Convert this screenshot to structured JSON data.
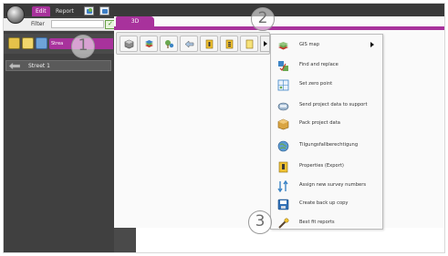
{
  "ribbon": {
    "tabs": [
      {
        "label": "Edit",
        "active": true
      },
      {
        "label": "Report",
        "active": false
      }
    ]
  },
  "filter": {
    "label": "Filter",
    "value": ""
  },
  "panel": {
    "active_tab_label": "Strea",
    "tree": [
      {
        "label": "Street 1",
        "icon": "street-icon"
      }
    ]
  },
  "view": {
    "tab_label": "3D"
  },
  "toolbar": {
    "buttons": [
      "3d-box-icon",
      "layers-icon",
      "tree-icon",
      "route-icon",
      "property-icon",
      "property-export-icon"
    ]
  },
  "menu": {
    "items": [
      {
        "label": "GIS map",
        "icon": "gis-map-icon",
        "has_submenu": true
      },
      {
        "label": "Find and replace",
        "icon": "find-replace-icon",
        "has_submenu": false
      },
      {
        "label": "Set zero point",
        "icon": "zero-point-icon",
        "has_submenu": false
      },
      {
        "label": "Send project data to support",
        "icon": "send-support-icon",
        "has_submenu": false
      },
      {
        "label": "Pack project data",
        "icon": "pack-icon",
        "has_submenu": false
      },
      {
        "label": "Tilgungsfallberechtigung",
        "icon": "globe-icon",
        "has_submenu": false
      },
      {
        "label": "Properties (Export)",
        "icon": "properties-export-icon",
        "has_submenu": false
      },
      {
        "label": "Assign new survey numbers",
        "icon": "survey-numbers-icon",
        "has_submenu": false
      },
      {
        "label": "Create back up copy",
        "icon": "backup-icon",
        "has_submenu": false
      },
      {
        "label": "Best fit reports",
        "icon": "best-fit-icon",
        "has_submenu": false
      }
    ]
  },
  "callouts": [
    "1",
    "2",
    "3"
  ],
  "colors": {
    "accent": "#a8329c",
    "panel_dark": "#404040"
  }
}
